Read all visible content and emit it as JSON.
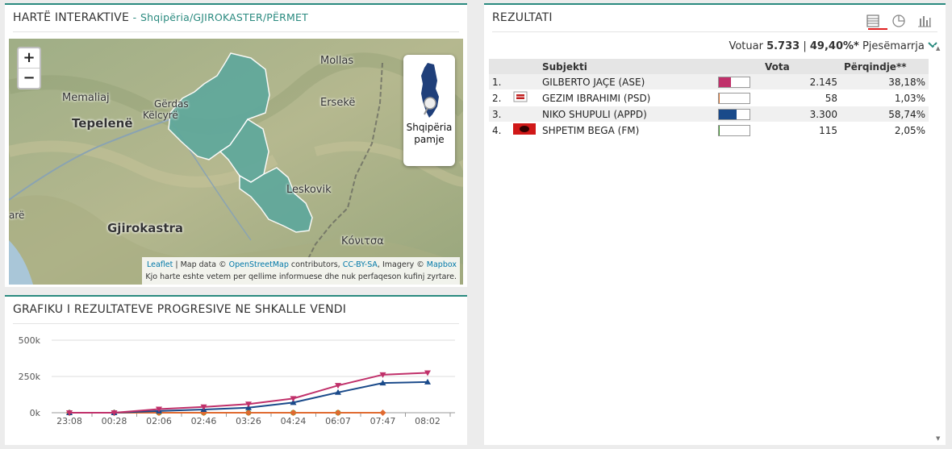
{
  "map_panel": {
    "title": "HARTË INTERAKTIVE",
    "separator": "-",
    "breadcrumb": "Shqipëria/GJIROKASTER/PËRMET",
    "zoom_in": "+",
    "zoom_out": "−",
    "albania_button": [
      "Shqipëria",
      "pamje"
    ],
    "attribution": {
      "leaflet": "Leaflet",
      "sep": " | Map data © ",
      "osm": "OpenStreetMap",
      "contributors": " contributors, ",
      "license": "CC-BY-SA",
      "imagery": ", Imagery © ",
      "mapbox": "Mapbox",
      "disclaimer": "Kjo harte eshte vetem per qellime informuese dhe nuk perfaqeson kufinj zyrtare."
    },
    "place_labels": [
      "Mollas",
      "Memaliaj",
      "Gërdas",
      "Këlcyrë",
      "Tepelenë",
      "Ersekë",
      "Leskovik",
      "arë",
      "Gjirokastra",
      "Κόνιτσα"
    ],
    "region_color": "#5fa89c"
  },
  "chart_panel": {
    "title": "GRAFIKU I REZULTATEVE PROGRESIVE NE SHKALLE VENDI"
  },
  "chart_data": {
    "type": "line",
    "title": "GRAFIKU I REZULTATEVE PROGRESIVE NE SHKALLE VENDI",
    "categories": [
      "23:08",
      "00:28",
      "02:06",
      "02:46",
      "03:26",
      "04:24",
      "06:07",
      "07:47",
      "08:02"
    ],
    "y_ticks": [
      "500k",
      "250k",
      "0k"
    ],
    "ylim": [
      0,
      500000
    ],
    "grid": true,
    "series": [
      {
        "color": "#c0306a",
        "marker": "triangle-down",
        "values": [
          0,
          0,
          25000,
          40000,
          60000,
          98000,
          188000,
          262000,
          275000
        ]
      },
      {
        "color": "#1a4a8a",
        "marker": "triangle-up",
        "values": [
          0,
          0,
          12000,
          22000,
          35000,
          70000,
          140000,
          205000,
          212000
        ]
      },
      {
        "color": "#e06a30",
        "marker": "diamond",
        "values": [
          0,
          0,
          0,
          0,
          0,
          0,
          0,
          0,
          null
        ]
      },
      {
        "color": "#6aa030",
        "marker": "circle",
        "values": [
          0,
          0,
          0,
          0,
          0,
          0,
          0,
          null,
          null
        ]
      }
    ]
  },
  "results_panel": {
    "title": "REZULTATI",
    "view_icons": [
      "table-view-icon",
      "pie-view-icon",
      "bar-view-icon"
    ],
    "turnout": {
      "label": "Votuar",
      "votes": "5.733",
      "sep": "|",
      "pct": "49,40%*",
      "pjesemarrja": "Pjesëmarrja"
    },
    "headers": {
      "subject": "Subjekti",
      "votes": "Vota",
      "pct": "Përqindje**"
    },
    "rows": [
      {
        "rank": "1.",
        "name": "GILBERTO JAÇE (ASE)",
        "votes": "2.145",
        "pct": "38,18%",
        "share": 38.18,
        "color": "#c0306a",
        "logo": "none"
      },
      {
        "rank": "2.",
        "name": "GEZIM IBRAHIMI (PSD)",
        "votes": "58",
        "pct": "1,03%",
        "share": 1.03,
        "color": "#d07030",
        "logo": "psd"
      },
      {
        "rank": "3.",
        "name": "NIKO SHUPULI (APPD)",
        "votes": "3.300",
        "pct": "58,74%",
        "share": 58.74,
        "color": "#1a4a8a",
        "logo": "none"
      },
      {
        "rank": "4.",
        "name": "SHPETIM BEGA (FM)",
        "votes": "115",
        "pct": "2,05%",
        "share": 2.05,
        "color": "#3a8a2a",
        "logo": "fm"
      }
    ]
  }
}
